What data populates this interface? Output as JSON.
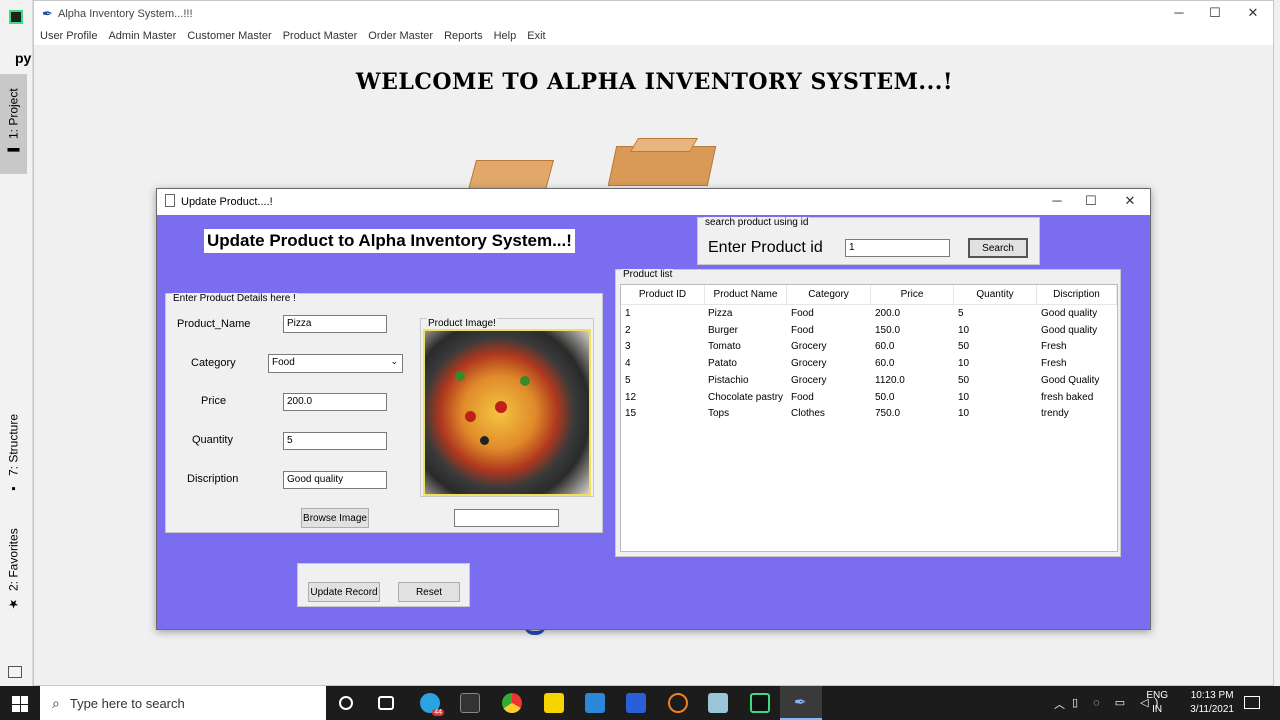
{
  "ide": {
    "label": "py",
    "tabs": [
      "1: Project",
      "7: Structure",
      "2: Favorites"
    ]
  },
  "main_window": {
    "title": "Alpha Inventory System...!!!",
    "menu": [
      "User Profile",
      "Admin Master",
      "Customer Master",
      "Product Master",
      "Order Master",
      "Reports",
      "Help",
      "Exit"
    ],
    "welcome": "WELCOME TO ALPHA INVENTORY SYSTEM...!"
  },
  "dialog": {
    "title": "Update Product....!",
    "heading": "Update Product to Alpha Inventory System...!",
    "search": {
      "frame_title": "search product using id",
      "label": "Enter Product id",
      "value": "1",
      "button": "Search"
    },
    "details": {
      "frame_title": "Enter Product Details here !",
      "name_label": "Product_Name",
      "name_value": "Pizza",
      "category_label": "Category",
      "category_value": "Food",
      "price_label": "Price",
      "price_value": "200.0",
      "quantity_label": "Quantity",
      "quantity_value": "5",
      "description_label": "Discription",
      "description_value": "Good quality",
      "image_label": "Product Image!",
      "browse_button": "Browse Image",
      "image_path_value": ""
    },
    "actions": {
      "update_button": "Update Record",
      "reset_button": "Reset"
    },
    "product_list": {
      "frame_title": "Product list",
      "columns": [
        "Product ID",
        "Product Name",
        "Category",
        "Price",
        "Quantity",
        "Discription"
      ],
      "rows": [
        [
          "1",
          "Pizza",
          "Food",
          "200.0",
          "5",
          "Good quality"
        ],
        [
          "2",
          "Burger",
          "Food",
          "150.0",
          "10",
          "Good quality"
        ],
        [
          "3",
          "Tomato",
          "Grocery",
          "60.0",
          "50",
          "Fresh"
        ],
        [
          "4",
          "Patato",
          "Grocery",
          "60.0",
          "10",
          "Fresh"
        ],
        [
          "5",
          "Pistachio",
          "Grocery",
          "1120.0",
          "50",
          "Good Quality"
        ],
        [
          "12",
          "Chocolate pastry",
          "Food",
          "50.0",
          "10",
          "fresh baked"
        ],
        [
          "15",
          "Tops",
          "Clothes",
          "750.0",
          "10",
          "trendy"
        ]
      ]
    }
  },
  "taskbar": {
    "search_placeholder": "Type here to search",
    "lang_top": "ENG",
    "lang_bottom": "IN",
    "time": "10:13 PM",
    "date": "3/11/2021",
    "badge": "44"
  },
  "colors": {
    "dialog_bg": "#7a6df0",
    "taskbar_bg": "#1c1c1c"
  }
}
